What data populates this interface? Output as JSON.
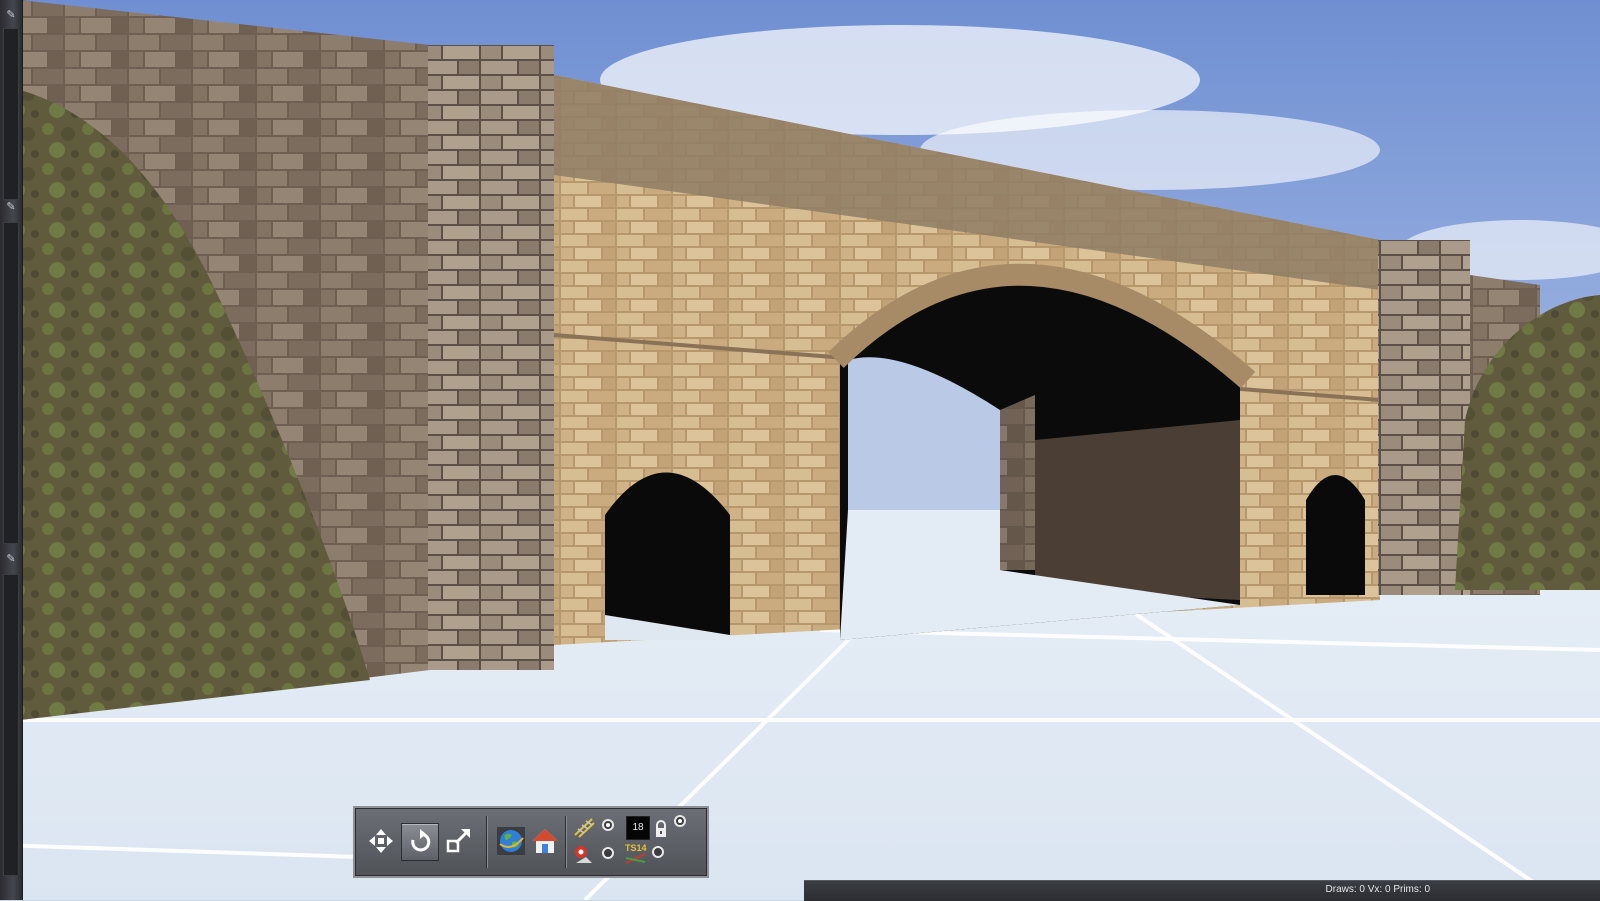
{
  "app": {
    "accent": "#6c7076"
  },
  "toolbar": {
    "buttons": [
      {
        "name": "move-tool",
        "icon": "arrows-cross-icon"
      },
      {
        "name": "rotate-tool",
        "icon": "rotate-icon",
        "active": true
      },
      {
        "name": "scale-tool",
        "icon": "scale-arrows-icon"
      },
      {
        "name": "globe-view",
        "icon": "globe-icon"
      },
      {
        "name": "home-view",
        "icon": "house-icon"
      }
    ],
    "speed_value": "18",
    "ts_label": "TS14"
  },
  "status": {
    "text": "Draws: 0 Vx: 0 Prims: 0"
  }
}
